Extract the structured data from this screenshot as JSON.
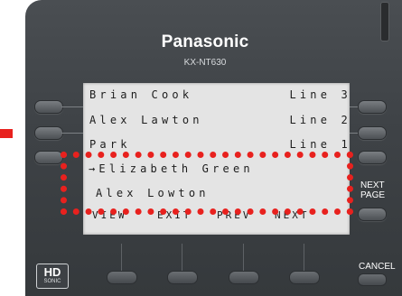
{
  "phone": {
    "brand": "Panasonic",
    "model": "KX-NT630"
  },
  "display": {
    "rows": [
      {
        "name": "Brian Cook",
        "line": "Line 3"
      },
      {
        "name": "Alex Lawton",
        "line": "Line 2"
      },
      {
        "name": "Park",
        "line": "Line 1"
      },
      {
        "name": "→Elizabeth Green",
        "line": ""
      },
      {
        "name": "Alex Lowton",
        "line": ""
      }
    ],
    "softkeys": [
      "VIEW",
      "EXIT",
      "PREV",
      "NEXT"
    ]
  },
  "buttons": {
    "next_page_line1": "NEXT",
    "next_page_line2": "PAGE",
    "cancel": "CANCEL"
  },
  "logo": {
    "hd": "HD",
    "sonic": "SONIC"
  },
  "colors": {
    "highlight": "#e8211e",
    "panel": "#3f4347",
    "lcd": "#e4e4e4"
  }
}
